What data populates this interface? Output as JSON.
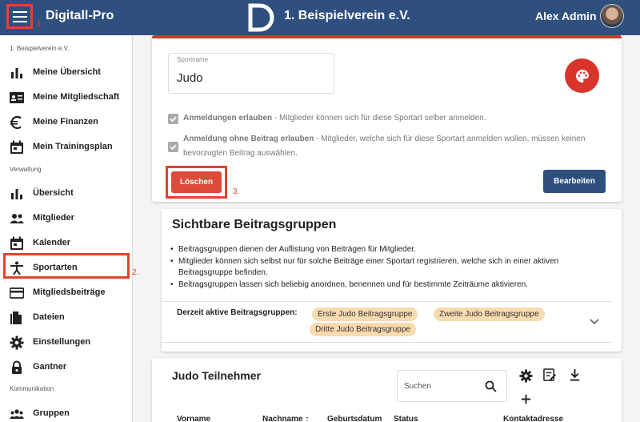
{
  "header": {
    "app_title": "Digitall-Pro",
    "club_name": "1. Beispielverein e.V.",
    "user_name": "Alex Admin",
    "menu_annotation": "1."
  },
  "sidebar": {
    "club_section": "1. Beispielverein e.V.",
    "personal_items": [
      {
        "label": "Meine Übersicht",
        "icon": "bar-chart-icon"
      },
      {
        "label": "Meine Mitgliedschaft",
        "icon": "id-card-icon"
      },
      {
        "label": "Meine Finanzen",
        "icon": "euro-icon"
      },
      {
        "label": "Mein Trainingsplan",
        "icon": "calendar-icon"
      }
    ],
    "admin_section": "Verwaltung",
    "admin_items": [
      {
        "label": "Übersicht",
        "icon": "bar-chart-icon"
      },
      {
        "label": "Mitglieder",
        "icon": "people-icon"
      },
      {
        "label": "Kalender",
        "icon": "calendar-icon"
      },
      {
        "label": "Sportarten",
        "icon": "sport-icon"
      },
      {
        "label": "Mitgliedsbeiträge",
        "icon": "credit-card-icon"
      },
      {
        "label": "Dateien",
        "icon": "file-icon"
      },
      {
        "label": "Einstellungen",
        "icon": "gear-icon"
      },
      {
        "label": "Gantner",
        "icon": "lock-icon"
      }
    ],
    "comm_section": "Kommunikation",
    "comm_items": [
      {
        "label": "Gruppen",
        "icon": "groups-icon"
      }
    ],
    "highlight_annotation": "2."
  },
  "sport_card": {
    "field_label": "Sportname",
    "field_value": "Judo",
    "checkbox1_bold": "Anmeldungen erlauben",
    "checkbox1_text": " - Mitglieder können sich für diese Sportart selber anmelden.",
    "checkbox2_bold": "Anmeldung ohne Beitrag erlauben",
    "checkbox2_text": " - Mitglieder, welche sich für diese Sportart anmelden wollen, müssen keinen bevorzugten Beitrag auswählen.",
    "delete_label": "Löschen",
    "edit_label": "Bearbeiten",
    "delete_annotation": "3."
  },
  "groups_card": {
    "title": "Sichtbare Beitragsgruppen",
    "bullets": [
      "Beitragsgruppen dienen der Auflistung von Beiträgen für Mitglieder.",
      "Mitglieder können sich selbst nur für solche Beiträge einer Sportart registrieren, welche sich in einer aktiven Beitragsgruppe befinden.",
      "Beitragsgruppen lassen sich beliebig anordnen, benennen und für bestimmte Zeiträume aktivieren."
    ],
    "active_label": "Derzeit aktive Beitragsgruppen:",
    "chips": [
      "Erste Judo Beitragsgruppe",
      "Zweite Judo Beitragsgruppe",
      "Dritte Judo Beitragsgruppe"
    ]
  },
  "participants_card": {
    "title": "Judo Teilnehmer",
    "search_placeholder": "Suchen",
    "columns": [
      "Vorname",
      "Nachname ↑",
      "Geburtsdatum",
      "Status",
      "Kontaktadresse"
    ]
  },
  "colors": {
    "primary": "#2f4f7f",
    "danger": "#d9342b",
    "annotation": "#e0432f",
    "chip": "#f9dbb0"
  }
}
